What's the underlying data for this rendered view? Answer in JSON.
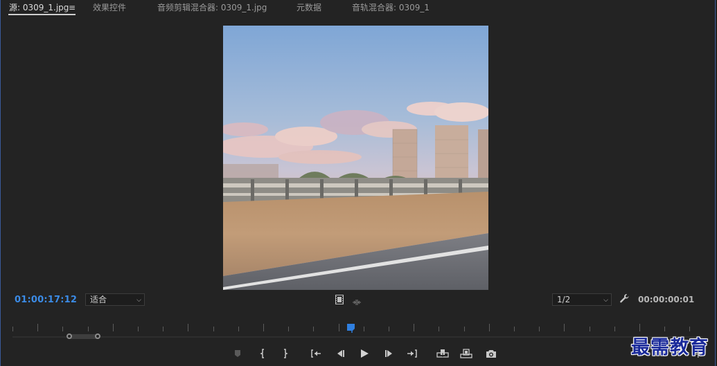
{
  "tabs": [
    {
      "label": "源: 0309_1.jpg",
      "active": true
    },
    {
      "label": "效果控件"
    },
    {
      "label": "音频剪辑混合器: 0309_1.jpg"
    },
    {
      "label": "元数据"
    },
    {
      "label": "音轨混合器: 0309_1"
    }
  ],
  "tab_menu_glyph": "≡",
  "timecode_current": "01:00:17:12",
  "timecode_duration": "00:00:00:01",
  "zoom_select": {
    "value": "适合"
  },
  "resolution_select": {
    "value": "1/2"
  },
  "watermark": "最需教育",
  "add_glyph": "+",
  "colors": {
    "accent": "#3b8be6",
    "panel_bg": "#232323",
    "border": "#3a5a9a"
  },
  "icons": [
    "hamburger-menu-icon",
    "wrench-icon",
    "film-strip-icon",
    "trim-icon",
    "marker-icon",
    "mark-in-icon",
    "mark-out-icon",
    "go-to-in-icon",
    "step-back-icon",
    "play-icon",
    "step-forward-icon",
    "go-to-out-icon",
    "insert-icon",
    "overwrite-icon",
    "camera-icon",
    "add-button-icon"
  ]
}
